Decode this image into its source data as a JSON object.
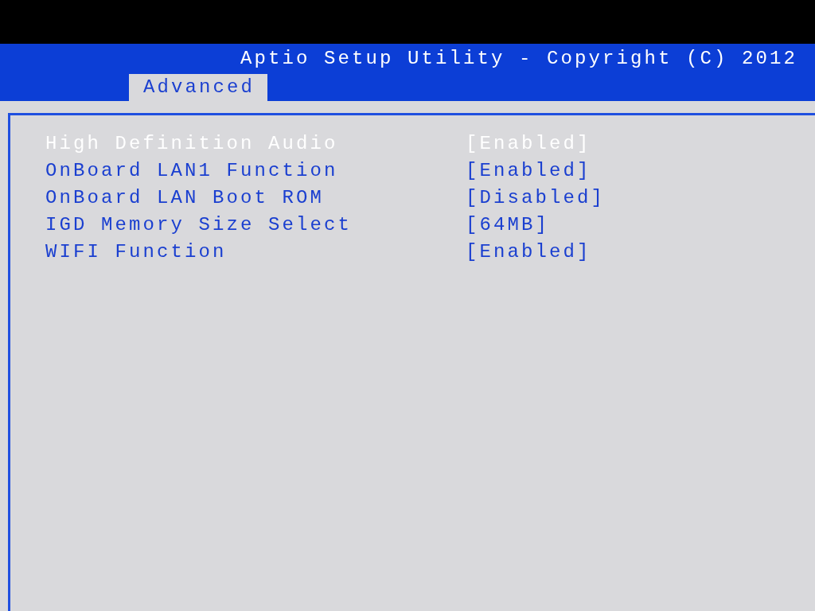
{
  "header": {
    "title": "Aptio Setup Utility - Copyright (C) 2012"
  },
  "tabs": [
    {
      "label": "Advanced",
      "selected": true
    }
  ],
  "settings": [
    {
      "name": "High Definition Audio",
      "value": "[Enabled]",
      "selected": true
    },
    {
      "name": "OnBoard LAN1 Function",
      "value": "[Enabled]",
      "selected": false
    },
    {
      "name": "OnBoard LAN Boot ROM",
      "value": "[Disabled]",
      "selected": false
    },
    {
      "name": "IGD Memory Size Select",
      "value": "[64MB]",
      "selected": false
    },
    {
      "name": "WIFI Function",
      "value": "[Enabled]",
      "selected": false
    }
  ]
}
